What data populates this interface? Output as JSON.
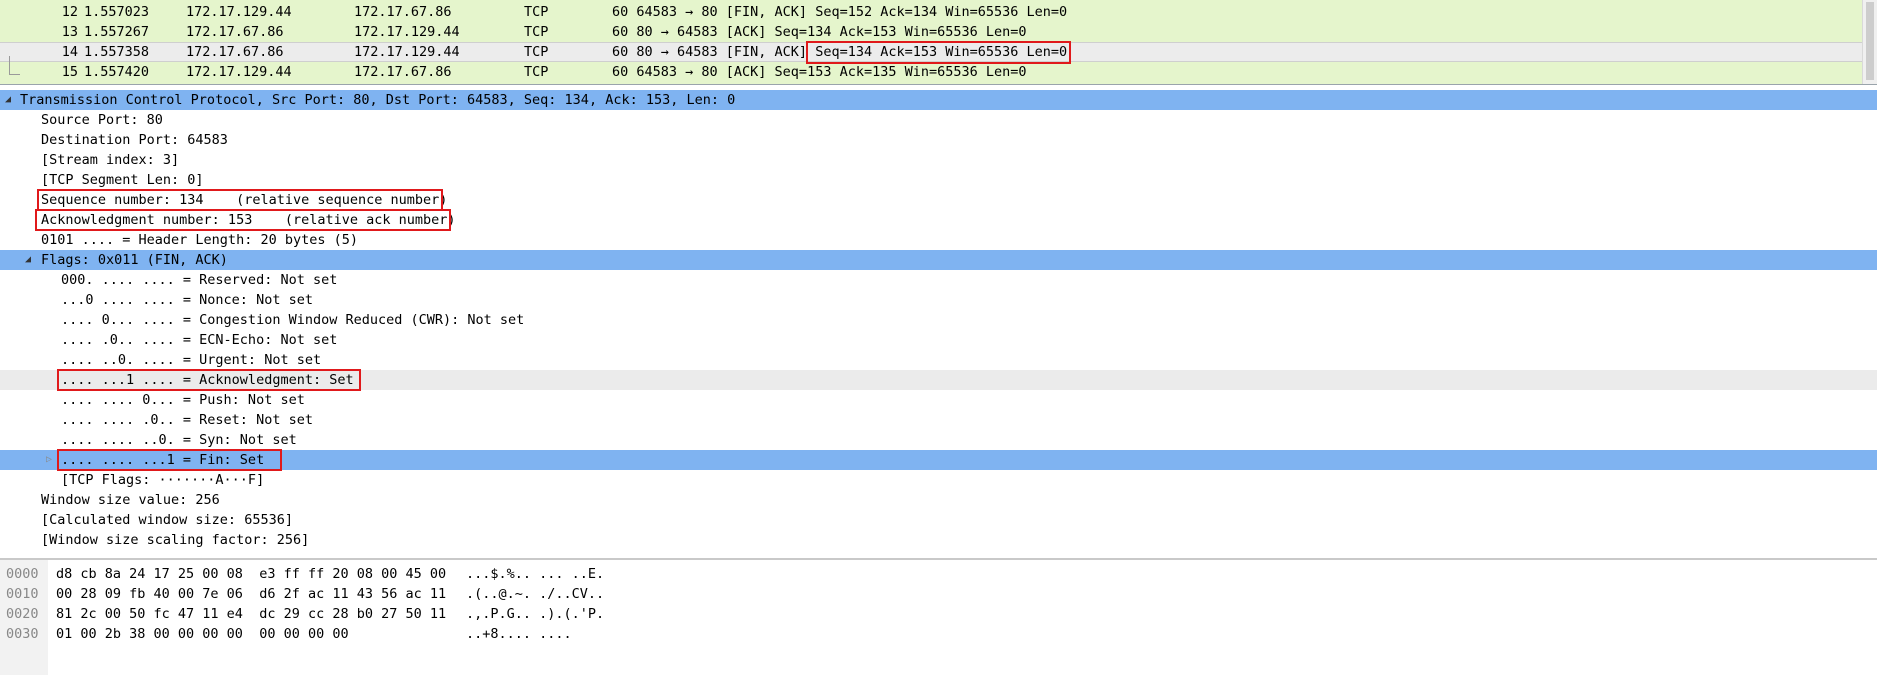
{
  "packet_list": {
    "rows": [
      {
        "no": "12",
        "time": "1.557023",
        "src": "172.17.129.44",
        "dst": "172.17.67.86",
        "proto": "TCP",
        "info": "60 64583 → 80 [FIN, ACK] Seq=152 Ack=134 Win=65536 Len=0"
      },
      {
        "no": "13",
        "time": "1.557267",
        "src": "172.17.67.86",
        "dst": "172.17.129.44",
        "proto": "TCP",
        "info": "60 80 → 64583 [ACK] Seq=134 Ack=153 Win=65536 Len=0"
      },
      {
        "no": "14",
        "time": "1.557358",
        "src": "172.17.67.86",
        "dst": "172.17.129.44",
        "proto": "TCP",
        "info": "60 80 → 64583 [FIN, ACK] Seq=134 Ack=153 Win=65536 Len=0"
      },
      {
        "no": "15",
        "time": "1.557420",
        "src": "172.17.129.44",
        "dst": "172.17.67.86",
        "proto": "TCP",
        "info": "60 64583 → 80 [ACK] Seq=153 Ack=135 Win=65536 Len=0"
      }
    ],
    "selected_index": 2
  },
  "details": {
    "rows": [
      {
        "text": "Transmission Control Protocol, Src Port: 80, Dst Port: 64583, Seq: 134, Ack: 153, Len: 0",
        "expander": "◢",
        "level": 0
      },
      {
        "text": "Source Port: 80",
        "level": 1
      },
      {
        "text": "Destination Port: 64583",
        "level": 1
      },
      {
        "text": "[Stream index: 3]",
        "level": 1
      },
      {
        "text": "[TCP Segment Len: 0]",
        "level": 1
      },
      {
        "text": "Sequence number: 134    (relative sequence number)",
        "level": 1
      },
      {
        "text": "Acknowledgment number: 153    (relative ack number)",
        "level": 1
      },
      {
        "text": "0101 .... = Header Length: 20 bytes (5)",
        "level": 1
      },
      {
        "text": "Flags: 0x011 (FIN, ACK)",
        "expander": "◢",
        "level": 1
      },
      {
        "text": "000. .... .... = Reserved: Not set",
        "level": 2
      },
      {
        "text": "...0 .... .... = Nonce: Not set",
        "level": 2
      },
      {
        "text": ".... 0... .... = Congestion Window Reduced (CWR): Not set",
        "level": 2
      },
      {
        "text": ".... .0.. .... = ECN-Echo: Not set",
        "level": 2
      },
      {
        "text": ".... ..0. .... = Urgent: Not set",
        "level": 2
      },
      {
        "text": ".... ...1 .... = Acknowledgment: Set",
        "level": 2
      },
      {
        "text": ".... .... 0... = Push: Not set",
        "level": 2
      },
      {
        "text": ".... .... .0.. = Reset: Not set",
        "level": 2
      },
      {
        "text": ".... .... ..0. = Syn: Not set",
        "level": 2
      },
      {
        "text": ".... .... ...1 = Fin: Set",
        "expander": "▷",
        "level": 2
      },
      {
        "text": "[TCP Flags: ·······A···F]",
        "level": 2
      },
      {
        "text": "Window size value: 256",
        "level": 1
      },
      {
        "text": "[Calculated window size: 65536]",
        "level": 1
      },
      {
        "text": "[Window size scaling factor: 256]",
        "level": 1
      }
    ]
  },
  "bytes": {
    "rows": [
      {
        "offset": "0000",
        "hex": "d8 cb 8a 24 17 25 00 08  e3 ff ff 20 08 00 45 00",
        "ascii": "...$.%.. ... ..E."
      },
      {
        "offset": "0010",
        "hex": "00 28 09 fb 40 00 7e 06  d6 2f ac 11 43 56 ac 11",
        "ascii": ".(..@.~. ./..CV.."
      },
      {
        "offset": "0020",
        "hex": "81 2c 00 50 fc 47 11 e4  dc 29 cc 28 b0 27 50 11",
        "ascii": ".,.P.G.. .).(.'P."
      },
      {
        "offset": "0030",
        "hex": "01 00 2b 38 00 00 00 00  00 00 00 00",
        "ascii": "..+8.... ...."
      }
    ]
  },
  "colors": {
    "packet_list_bg": "#e5f5cc",
    "selection_blue": "#7fb3f1",
    "annotation_red": "#e0191b"
  }
}
